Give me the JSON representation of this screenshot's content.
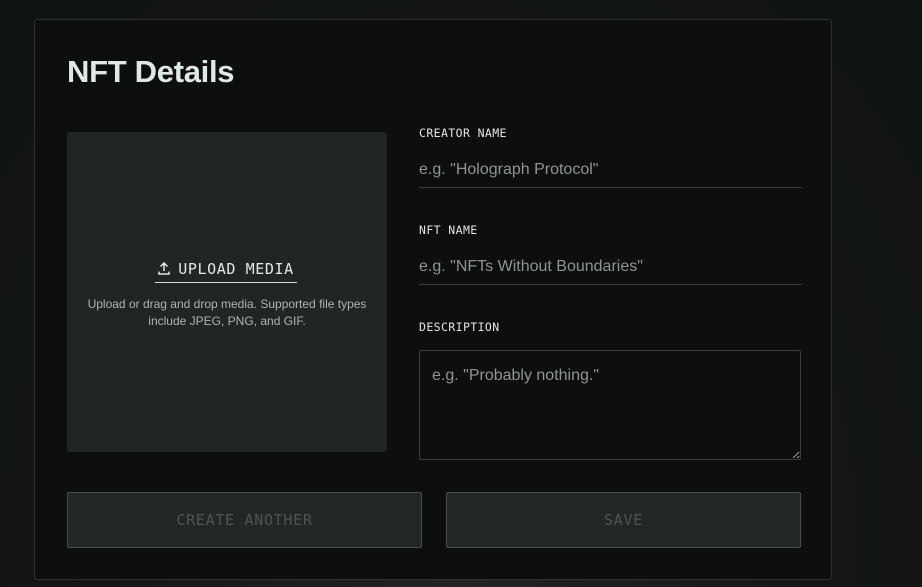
{
  "form": {
    "title": "NFT Details",
    "upload": {
      "icon": "upload-icon",
      "label": "UPLOAD MEDIA",
      "help": "Upload or drag and drop media. Supported file types include JPEG, PNG, and GIF."
    },
    "fields": {
      "creator_name": {
        "label": "CREATOR NAME",
        "value": "",
        "placeholder": "e.g. \"Holograph Protocol\""
      },
      "nft_name": {
        "label": "NFT NAME",
        "value": "",
        "placeholder": "e.g. \"NFTs Without Boundaries\""
      },
      "description": {
        "label": "DESCRIPTION",
        "value": "",
        "placeholder": "e.g. \"Probably nothing.\""
      }
    },
    "buttons": {
      "create_another": "CREATE ANOTHER",
      "save": "SAVE"
    }
  },
  "colors": {
    "card_background": "#0d0e0e",
    "upload_background": "#222526",
    "title_text": "#dfe9e5",
    "placeholder_text": "#8f9594",
    "disabled_button_text": "#4e5354"
  }
}
